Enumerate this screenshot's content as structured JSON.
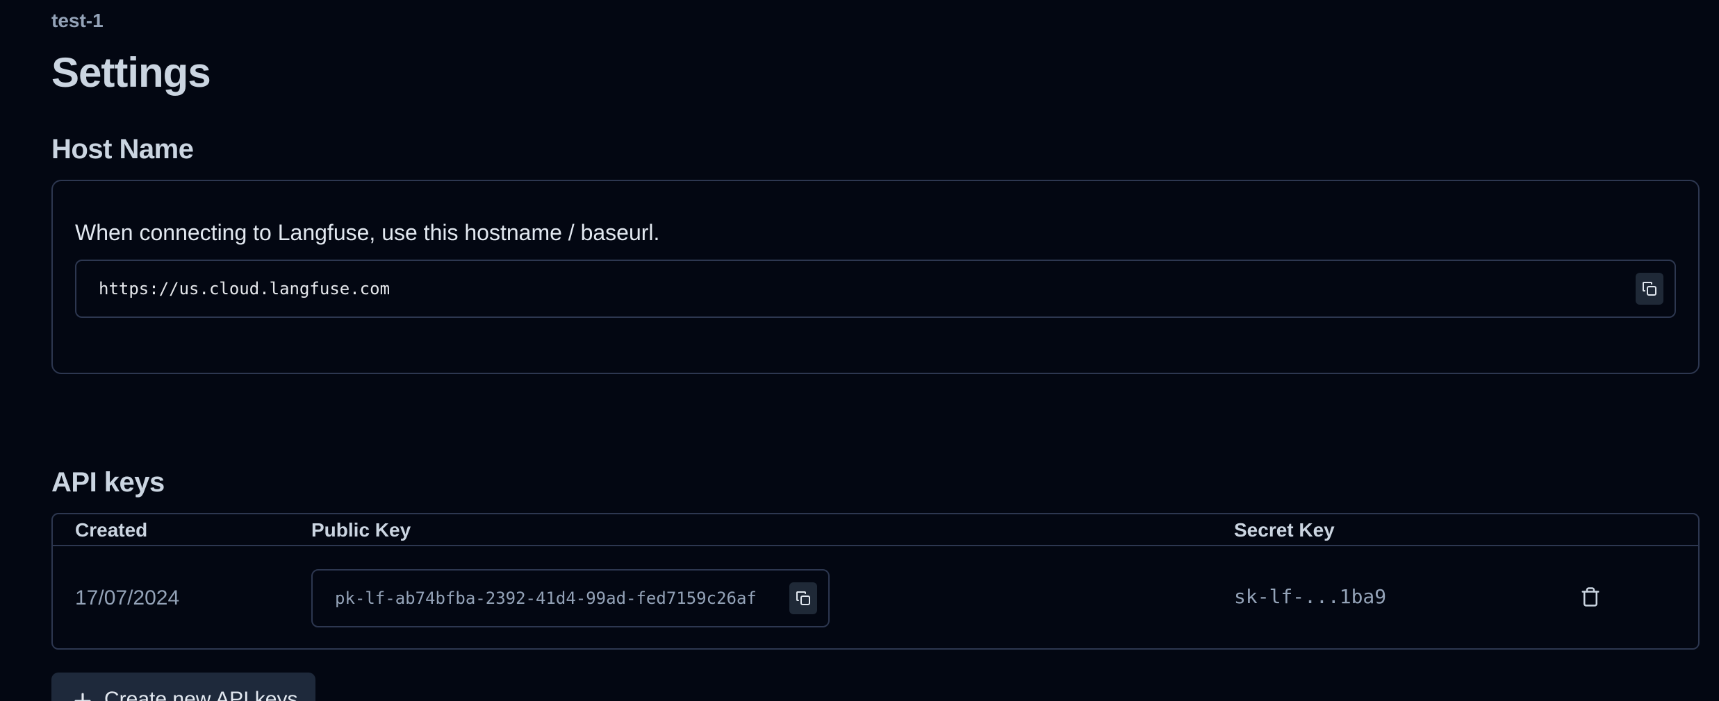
{
  "header": {
    "project_name": "test-1",
    "title": "Settings"
  },
  "host": {
    "section_title": "Host Name",
    "description": "When connecting to Langfuse, use this hostname / baseurl.",
    "url": "https://us.cloud.langfuse.com"
  },
  "api_keys": {
    "section_title": "API keys",
    "columns": [
      "Created",
      "Public Key",
      "Secret Key"
    ],
    "rows": [
      {
        "created": "17/07/2024",
        "public_key": "pk-lf-ab74bfba-2392-41d4-99ad-fed7159c26af",
        "secret_key": "sk-lf-...1ba9"
      }
    ],
    "create_button_label": "Create new API keys"
  },
  "icons": {
    "copy": "copy-icon",
    "delete": "trash-icon",
    "add": "plus-icon"
  },
  "colors": {
    "background": "#030712",
    "border": "#2d3750",
    "text_primary": "#e2e8f0",
    "text_muted": "#94a3b8",
    "button_bg": "#1e293b"
  }
}
